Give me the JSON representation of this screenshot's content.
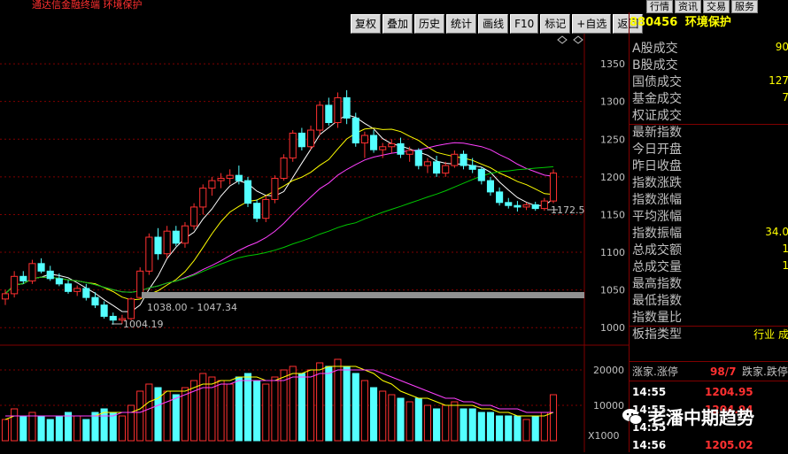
{
  "app": {
    "title": "通达信金融终端  环境保护"
  },
  "toolbar": [
    "复权",
    "叠加",
    "历史",
    "统计",
    "画线",
    "F10",
    "标记",
    "+自选",
    "返回"
  ],
  "topnav": [
    "行情",
    "资讯",
    "交易",
    "服务"
  ],
  "stock": {
    "code": "880456",
    "name": "环境保护"
  },
  "price_axis": [
    "1350",
    "1300",
    "1250",
    "1200",
    "1150",
    "1100",
    "1050",
    "1000"
  ],
  "price_labels": {
    "last": "1172.5",
    "range": "1038.00 - 1047.34",
    "low": "1004.19"
  },
  "vol_axis": [
    "20000",
    "10000"
  ],
  "vol_unit": "X1000",
  "info": [
    {
      "label": "A股成交",
      "value": "90"
    },
    {
      "label": "B股成交",
      "value": ""
    },
    {
      "label": "国债成交",
      "value": "127"
    },
    {
      "label": "基金成交",
      "value": "7"
    },
    {
      "label": "权证成交",
      "value": ""
    },
    {
      "label": "最新指数",
      "value": ""
    },
    {
      "label": "今日开盘",
      "value": ""
    },
    {
      "label": "昨日收盘",
      "value": ""
    },
    {
      "label": "指数涨跌",
      "value": ""
    },
    {
      "label": "指数涨幅",
      "value": ""
    },
    {
      "label": "平均涨幅",
      "value": ""
    },
    {
      "label": "指数振幅",
      "value": "34.0"
    },
    {
      "label": "总成交额",
      "value": "1"
    },
    {
      "label": "总成交量",
      "value": "1"
    },
    {
      "label": "最高指数",
      "value": ""
    },
    {
      "label": "最低指数",
      "value": ""
    },
    {
      "label": "指数量比",
      "value": ""
    },
    {
      "label": "板指类型",
      "value": "行业 成"
    }
  ],
  "updown": {
    "rise_label": "涨家.涨停",
    "rise_value": "98/7",
    "fall_label": "跌家.跌停"
  },
  "ticks": [
    {
      "time": "14:55",
      "price": "1204.95"
    },
    {
      "time": "14:55",
      "price": "1204.94"
    },
    {
      "time": "14:55",
      "price": ""
    },
    {
      "time": "14:56",
      "price": "1205.02"
    }
  ],
  "watermark": "老潘中期趋势",
  "colors": {
    "up": "#ff3030",
    "down": "#54ffff",
    "ma5": "#ffffff",
    "ma10": "#ffff00",
    "ma20": "#ff40ff",
    "ma60": "#00c800",
    "ma120": "#4040ff",
    "ma250": "#c8c8c8"
  },
  "chart_data": {
    "type": "candlestick",
    "ylim": [
      985,
      1390
    ],
    "candles": [
      [
        1038,
        1050,
        1030,
        1045
      ],
      [
        1045,
        1075,
        1040,
        1068
      ],
      [
        1068,
        1075,
        1058,
        1062
      ],
      [
        1062,
        1090,
        1058,
        1085
      ],
      [
        1085,
        1092,
        1072,
        1075
      ],
      [
        1075,
        1082,
        1062,
        1065
      ],
      [
        1065,
        1072,
        1055,
        1058
      ],
      [
        1058,
        1063,
        1045,
        1048
      ],
      [
        1048,
        1056,
        1042,
        1052
      ],
      [
        1052,
        1058,
        1036,
        1040
      ],
      [
        1040,
        1047,
        1026,
        1030
      ],
      [
        1030,
        1035,
        1012,
        1015
      ],
      [
        1015,
        1020,
        1004,
        1010
      ],
      [
        1010,
        1017,
        1005,
        1012
      ],
      [
        1012,
        1040,
        1010,
        1038
      ],
      [
        1040,
        1080,
        1038,
        1075
      ],
      [
        1075,
        1125,
        1070,
        1120
      ],
      [
        1120,
        1132,
        1090,
        1098
      ],
      [
        1098,
        1135,
        1092,
        1128
      ],
      [
        1128,
        1135,
        1108,
        1112
      ],
      [
        1112,
        1140,
        1106,
        1135
      ],
      [
        1135,
        1165,
        1130,
        1160
      ],
      [
        1160,
        1190,
        1150,
        1185
      ],
      [
        1185,
        1200,
        1175,
        1195
      ],
      [
        1195,
        1205,
        1185,
        1198
      ],
      [
        1198,
        1210,
        1190,
        1202
      ],
      [
        1202,
        1215,
        1190,
        1195
      ],
      [
        1195,
        1200,
        1160,
        1165
      ],
      [
        1165,
        1170,
        1140,
        1145
      ],
      [
        1145,
        1175,
        1140,
        1170
      ],
      [
        1170,
        1202,
        1165,
        1198
      ],
      [
        1198,
        1230,
        1195,
        1225
      ],
      [
        1225,
        1262,
        1220,
        1258
      ],
      [
        1258,
        1265,
        1235,
        1240
      ],
      [
        1240,
        1268,
        1236,
        1262
      ],
      [
        1262,
        1300,
        1255,
        1295
      ],
      [
        1295,
        1305,
        1268,
        1272
      ],
      [
        1272,
        1312,
        1265,
        1305
      ],
      [
        1305,
        1315,
        1270,
        1278
      ],
      [
        1278,
        1285,
        1240,
        1245
      ],
      [
        1245,
        1260,
        1225,
        1255
      ],
      [
        1255,
        1262,
        1232,
        1236
      ],
      [
        1236,
        1245,
        1225,
        1240
      ],
      [
        1240,
        1250,
        1232,
        1244
      ],
      [
        1244,
        1252,
        1225,
        1230
      ],
      [
        1230,
        1240,
        1220,
        1235
      ],
      [
        1235,
        1238,
        1210,
        1215
      ],
      [
        1215,
        1225,
        1205,
        1220
      ],
      [
        1220,
        1228,
        1200,
        1205
      ],
      [
        1205,
        1220,
        1200,
        1215
      ],
      [
        1215,
        1235,
        1212,
        1230
      ],
      [
        1230,
        1235,
        1210,
        1215
      ],
      [
        1215,
        1225,
        1205,
        1210
      ],
      [
        1210,
        1213,
        1190,
        1195
      ],
      [
        1195,
        1200,
        1175,
        1180
      ],
      [
        1180,
        1186,
        1162,
        1166
      ],
      [
        1166,
        1172,
        1158,
        1162
      ],
      [
        1162,
        1168,
        1154,
        1160
      ],
      [
        1160,
        1166,
        1156,
        1163
      ],
      [
        1163,
        1167,
        1155,
        1158
      ],
      [
        1158,
        1172,
        1155,
        1168
      ],
      [
        1168,
        1210,
        1165,
        1205
      ]
    ],
    "volume": [
      6,
      9,
      7,
      8,
      7,
      6,
      7,
      8,
      7,
      6,
      8,
      9,
      8,
      7,
      10,
      14,
      16,
      15,
      14,
      13,
      15,
      17,
      19,
      18,
      17,
      16,
      18,
      19,
      17,
      16,
      18,
      20,
      21,
      19,
      20,
      22,
      21,
      23,
      21,
      19,
      17,
      15,
      14,
      13,
      12,
      11,
      12,
      10,
      9,
      10,
      11,
      9,
      9,
      8,
      8,
      7,
      7,
      7,
      6,
      7,
      8,
      13
    ],
    "vol_ma5": [
      6,
      7,
      7,
      7,
      7,
      7,
      7,
      7,
      7,
      7,
      7,
      8,
      8,
      8,
      8,
      9,
      11,
      12,
      14,
      14,
      14,
      15,
      16,
      16,
      17,
      17,
      18,
      18,
      18,
      17,
      17,
      18,
      19,
      19,
      20,
      20,
      21,
      21,
      21,
      21,
      20,
      19,
      17,
      16,
      14,
      13,
      12,
      12,
      11,
      10,
      10,
      10,
      10,
      9,
      9,
      8,
      8,
      7,
      7,
      7,
      7,
      8
    ],
    "vol_ma10": [
      7,
      7,
      7,
      7,
      7,
      7,
      7,
      7,
      7,
      7,
      7,
      7,
      7,
      8,
      8,
      8,
      9,
      10,
      11,
      12,
      13,
      14,
      15,
      15,
      16,
      16,
      17,
      17,
      17,
      17,
      17,
      17,
      18,
      18,
      18,
      19,
      19,
      20,
      20,
      20,
      20,
      20,
      19,
      18,
      17,
      16,
      15,
      14,
      13,
      12,
      12,
      11,
      11,
      10,
      10,
      9,
      9,
      9,
      8,
      8,
      8,
      8
    ]
  }
}
